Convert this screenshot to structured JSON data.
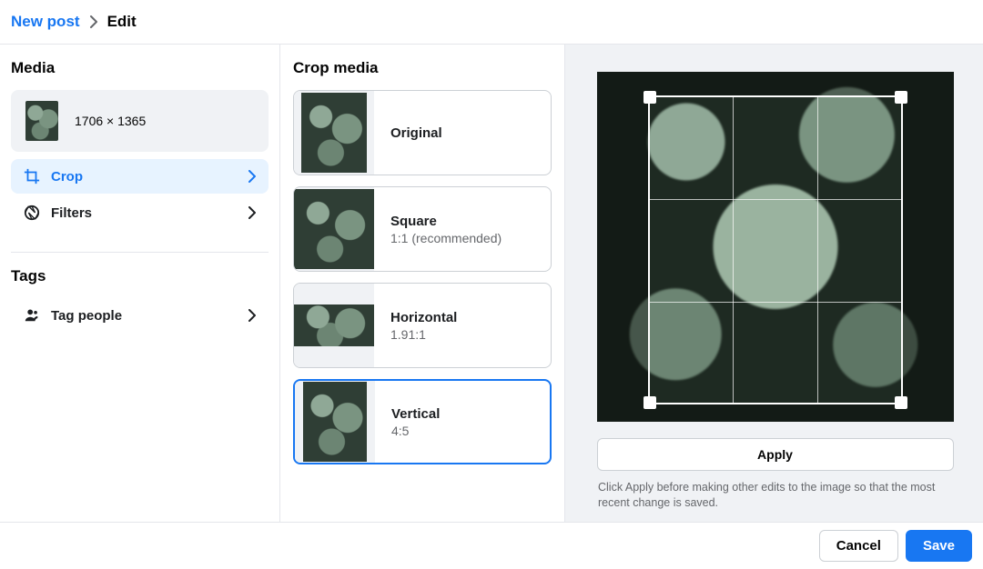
{
  "breadcrumb": {
    "parent": "New post",
    "current": "Edit"
  },
  "sidebar": {
    "media_title": "Media",
    "dimensions": "1706 × 1365",
    "crop_label": "Crop",
    "filters_label": "Filters",
    "tags_title": "Tags",
    "tag_people_label": "Tag people"
  },
  "crop": {
    "title": "Crop media",
    "options": [
      {
        "title": "Original",
        "sub": ""
      },
      {
        "title": "Square",
        "sub": "1:1 (recommended)"
      },
      {
        "title": "Horizontal",
        "sub": "1.91:1"
      },
      {
        "title": "Vertical",
        "sub": "4:5"
      }
    ],
    "apply_label": "Apply",
    "hint": "Click Apply before making other edits to the image so that the most recent change is saved."
  },
  "footer": {
    "cancel": "Cancel",
    "save": "Save"
  }
}
